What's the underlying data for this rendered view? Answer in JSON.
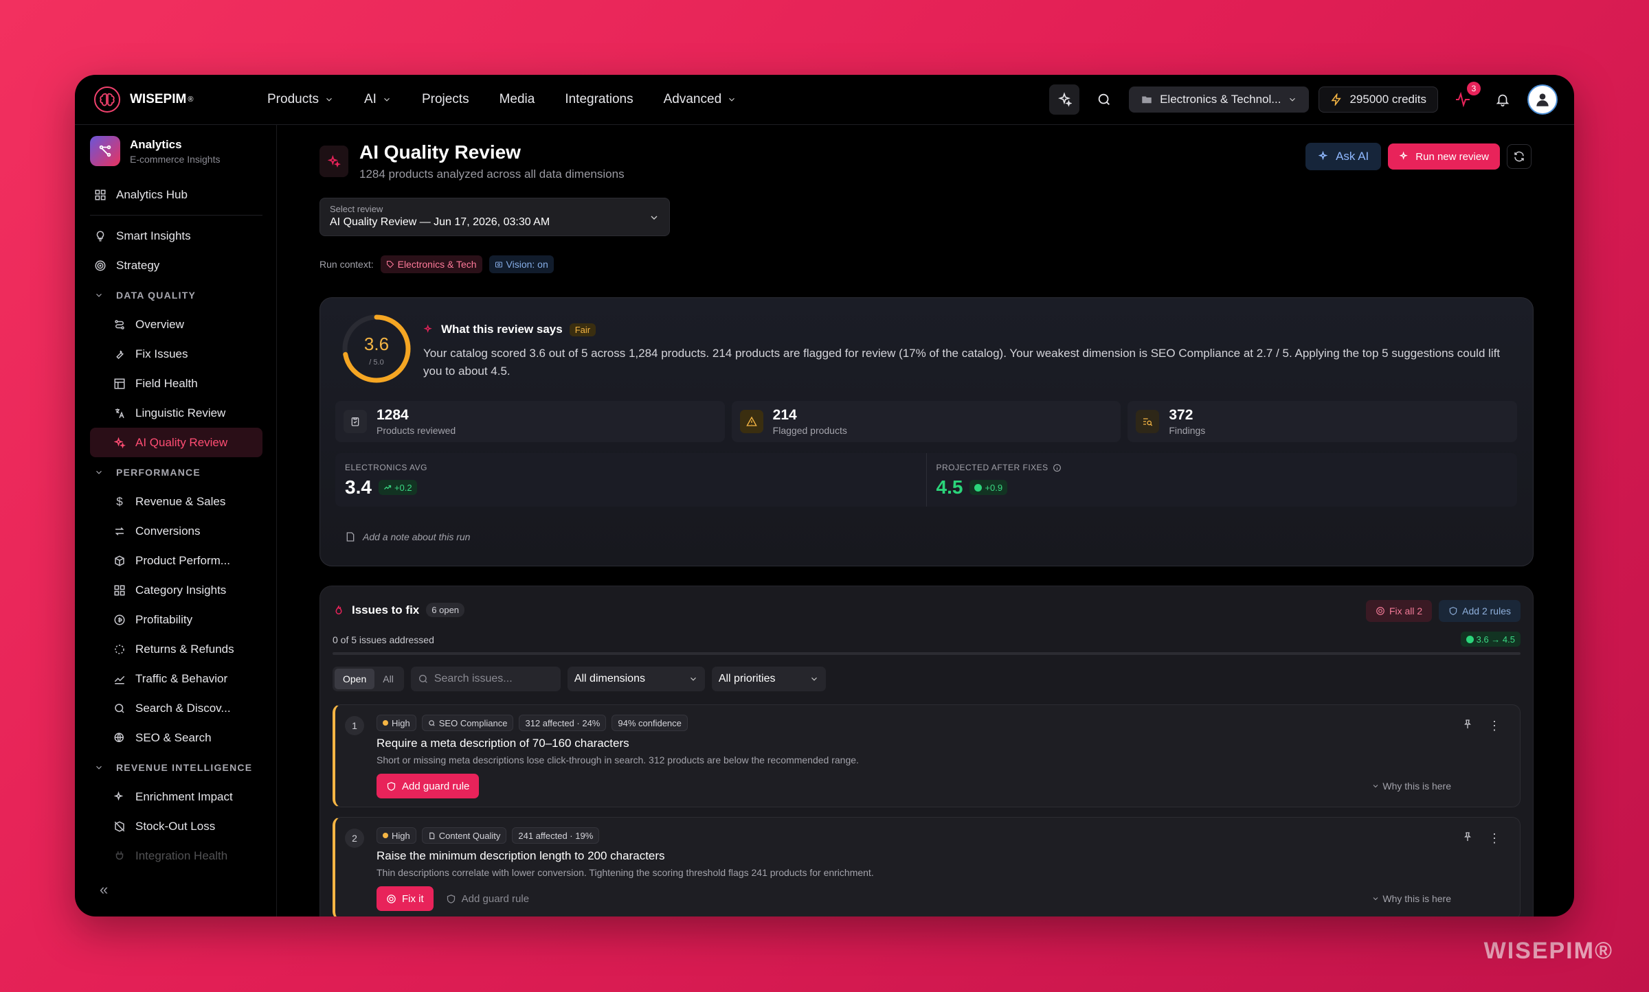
{
  "brand": {
    "name": "WISEPIM",
    "reg": "®",
    "watermark": "WISEPIM®"
  },
  "nav": [
    {
      "label": "Products",
      "dropdown": true
    },
    {
      "label": "AI",
      "dropdown": true
    },
    {
      "label": "Projects"
    },
    {
      "label": "Media"
    },
    {
      "label": "Integrations"
    },
    {
      "label": "Advanced",
      "dropdown": true
    }
  ],
  "topbar": {
    "workspace": "Electronics & Technol...",
    "credits": "295000 credits",
    "notifications": "3"
  },
  "sidebar": {
    "title": "Analytics",
    "subtitle": "E-commerce Insights",
    "hub": "Analytics Hub",
    "top_items": [
      "Smart Insights",
      "Strategy"
    ],
    "sections": [
      {
        "label": "DATA QUALITY",
        "items": [
          "Overview",
          "Fix Issues",
          "Field Health",
          "Linguistic Review",
          "AI Quality Review"
        ]
      },
      {
        "label": "PERFORMANCE",
        "items": [
          "Revenue & Sales",
          "Conversions",
          "Product Perform...",
          "Category Insights",
          "Profitability",
          "Returns & Refunds",
          "Traffic & Behavior",
          "Search & Discov...",
          "SEO & Search"
        ]
      },
      {
        "label": "REVENUE INTELLIGENCE",
        "items": [
          "Enrichment Impact",
          "Stock-Out Loss",
          "Integration Health"
        ]
      }
    ],
    "active": "AI Quality Review"
  },
  "header": {
    "title": "AI Quality Review",
    "subtitle": "1284 products analyzed across all data dimensions",
    "ask_ai": "Ask AI",
    "run_review": "Run new review"
  },
  "select_review": {
    "label": "Select review",
    "value": "AI Quality Review — Jun 17, 2026, 03:30 AM"
  },
  "run_context": {
    "label": "Run context:",
    "tags": [
      "Electronics & Tech",
      "Vision: on"
    ]
  },
  "summary": {
    "score": "3.6",
    "score_max": "/ 5.0",
    "score_fraction": 0.72,
    "heading": "What this review says",
    "rating": "Fair",
    "text": "Your catalog scored 3.6 out of 5 across 1,284 products. 214 products are flagged for review (17% of the catalog). Your weakest dimension is SEO Compliance at 2.7 / 5. Applying the top 5 suggestions could lift you to about 4.5.",
    "stats": [
      {
        "value": "1284",
        "label": "Products reviewed"
      },
      {
        "value": "214",
        "label": "Flagged products"
      },
      {
        "value": "372",
        "label": "Findings"
      }
    ],
    "avg": {
      "label": "ELECTRONICS AVG",
      "value": "3.4",
      "delta": "+0.2"
    },
    "projected": {
      "label": "PROJECTED AFTER FIXES",
      "value": "4.5",
      "delta": "+0.9"
    },
    "note": "Add a note about this run"
  },
  "issues": {
    "title": "Issues to fix",
    "open_badge": "6 open",
    "fix_all": "Fix all 2",
    "add_rules": "Add 2 rules",
    "addressed": "0 of 5 issues addressed",
    "progress_label": "3.6 → 4.5",
    "progress_fraction": 0.0,
    "filters": {
      "tabs": [
        "Open",
        "All"
      ],
      "search_placeholder": "Search issues...",
      "dimensions": "All dimensions",
      "priorities": "All priorities"
    },
    "items": [
      {
        "num": "1",
        "priority": "High",
        "dimension": "SEO Compliance",
        "affected": "312 affected · 24%",
        "confidence": "94% confidence",
        "title": "Require a meta description of 70–160 characters",
        "desc": "Short or missing meta descriptions lose click-through in search. 312 products are below the recommended range.",
        "primary": "Add guard rule",
        "secondary": "",
        "why": "Why this is here"
      },
      {
        "num": "2",
        "priority": "High",
        "dimension": "Content Quality",
        "affected": "241 affected · 19%",
        "confidence": "",
        "title": "Raise the minimum description length to 200 characters",
        "desc": "Thin descriptions correlate with lower conversion. Tightening the scoring threshold flags 241 products for enrichment.",
        "primary": "Fix it",
        "secondary": "Add guard rule",
        "why": "Why this is here"
      }
    ]
  },
  "colors": {
    "accent": "#e8235a",
    "warning": "#f5b544",
    "success": "#2bd47a",
    "info": "#8fb8ff"
  }
}
